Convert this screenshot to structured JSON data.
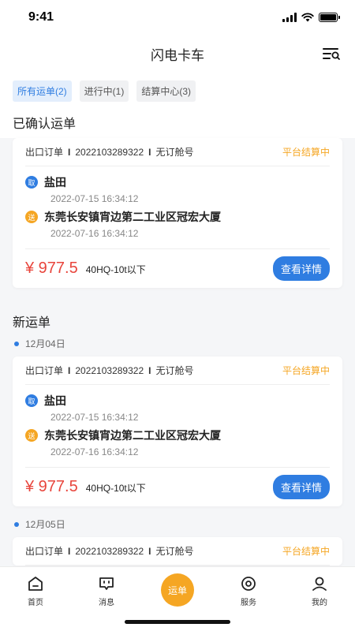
{
  "status_bar": {
    "time": "9:41"
  },
  "header": {
    "title": "闪电卡车",
    "menu_icon": "filter-search-icon"
  },
  "tabs": [
    {
      "label": "所有运单(2)",
      "active": true
    },
    {
      "label": "进行中(1)",
      "active": false
    },
    {
      "label": "结算中心(3)",
      "active": false
    }
  ],
  "confirmed": {
    "title": "已确认运单",
    "card": {
      "order_type": "出口订单",
      "order_no": "2022103289322",
      "booking": "无订舱号",
      "status": "平台结算中",
      "pickup_badge": "取",
      "pickup_name": "盐田",
      "pickup_time": "2022-07-15 16:34:12",
      "drop_badge": "送",
      "drop_name": "东莞长安镇宵边第二工业区冠宏大厦",
      "drop_time": "2022-07-16 16:34:12",
      "price": "¥ 977.5",
      "spec": "40HQ-10t以下",
      "detail_button": "查看详情"
    }
  },
  "new_orders": {
    "title": "新运单",
    "groups": [
      {
        "date": "12月04日",
        "card": {
          "order_type": "出口订单",
          "order_no": "2022103289322",
          "booking": "无订舱号",
          "status": "平台结算中",
          "pickup_badge": "取",
          "pickup_name": "盐田",
          "pickup_time": "2022-07-15 16:34:12",
          "drop_badge": "送",
          "drop_name": "东莞长安镇宵边第二工业区冠宏大厦",
          "drop_time": "2022-07-16 16:34:12",
          "price": "¥ 977.5",
          "spec": "40HQ-10t以下",
          "detail_button": "查看详情"
        }
      },
      {
        "date": "12月05日",
        "card": {
          "order_type": "出口订单",
          "order_no": "2022103289322",
          "booking": "无订舱号",
          "status": "平台结算中"
        }
      }
    ]
  },
  "tabbar": {
    "items": [
      {
        "label": "首页",
        "icon": "home-icon"
      },
      {
        "label": "消息",
        "icon": "message-icon"
      },
      {
        "label": "运单",
        "icon": "waybill-icon"
      },
      {
        "label": "服务",
        "icon": "service-icon"
      },
      {
        "label": "我的",
        "icon": "profile-icon"
      }
    ]
  },
  "colors": {
    "primary": "#2f7de1",
    "accent": "#f5a623",
    "price": "#e8453c"
  }
}
